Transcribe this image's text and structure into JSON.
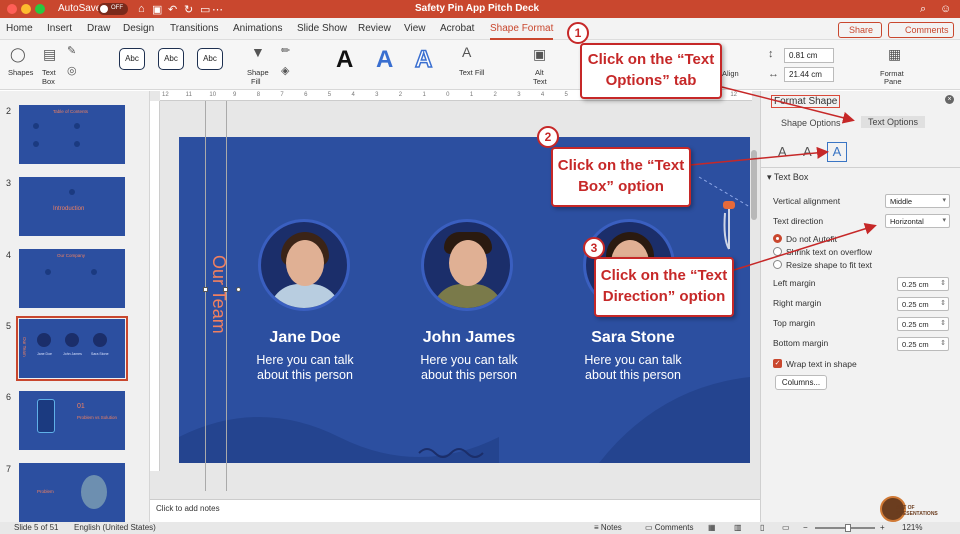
{
  "window": {
    "autosave_label": "AutoSave",
    "autosave_state": "OFF",
    "title": "Safety Pin App Pitch Deck"
  },
  "ribbon_tabs": [
    "Home",
    "Insert",
    "Draw",
    "Design",
    "Transitions",
    "Animations",
    "Slide Show",
    "Review",
    "View",
    "Acrobat",
    "Shape Format"
  ],
  "active_tab": "Shape Format",
  "header_buttons": {
    "share": "Share",
    "comments": "Comments"
  },
  "toolbar": {
    "shapes": "Shapes",
    "text_box_1": "Text",
    "text_box_2": "Box",
    "style_sample": "Abc",
    "shape_fill_1": "Shape",
    "shape_fill_2": "Fill",
    "wordart_letter": "A",
    "text_fill": "Text Fill",
    "alt_text_1": "Alt",
    "alt_text_2": "Text",
    "align": "Align",
    "height": "0.81 cm",
    "width": "21.44 cm",
    "format_pane_1": "Format",
    "format_pane_2": "Pane"
  },
  "slides": [
    {
      "num": "2",
      "title": "Table of Contents"
    },
    {
      "num": "3",
      "title": "Introduction"
    },
    {
      "num": "4",
      "title": "Our Company"
    },
    {
      "num": "5",
      "title": "Our Team"
    },
    {
      "num": "6",
      "title": "01",
      "subtitle": "Problem vs Solution"
    },
    {
      "num": "7",
      "title": "Problem"
    }
  ],
  "ruler_labels": [
    "12",
    "11",
    "10",
    "9",
    "8",
    "7",
    "6",
    "5",
    "4",
    "3",
    "2",
    "1",
    "0",
    "1",
    "2",
    "3",
    "4",
    "5",
    "6",
    "7",
    "8",
    "9",
    "10",
    "11",
    "12"
  ],
  "slide": {
    "title": "Our Team",
    "people": [
      {
        "name": "Jane Doe",
        "desc1": "Here you can talk",
        "desc2": "about this person"
      },
      {
        "name": "John James",
        "desc1": "Here you can talk",
        "desc2": "about this person"
      },
      {
        "name": "Sara Stone",
        "desc1": "Here you can talk",
        "desc2": "about this person"
      }
    ]
  },
  "notes_placeholder": "Click to add notes",
  "status": {
    "slide_of": "Slide 5 of 51",
    "language": "English (United States)",
    "notes": "Notes",
    "comments": "Comments",
    "zoom": "121%"
  },
  "format_pane": {
    "title": "Format Shape",
    "tab_shape": "Shape Options",
    "tab_text": "Text Options",
    "section": "Text Box",
    "vertical_alignment_label": "Vertical alignment",
    "vertical_alignment_value": "Middle",
    "text_direction_label": "Text direction",
    "text_direction_value": "Horizontal",
    "do_not_autofit": "Do not Autofit",
    "shrink_text": "Shrink text on overflow",
    "resize_shape": "Resize shape to fit text",
    "left_margin_label": "Left margin",
    "left_margin": "0.25 cm",
    "right_margin_label": "Right margin",
    "right_margin": "0.25 cm",
    "top_margin_label": "Top margin",
    "top_margin": "0.25 cm",
    "bottom_margin_label": "Bottom margin",
    "bottom_margin": "0.25 cm",
    "wrap_text": "Wrap text in shape",
    "columns_button": "Columns..."
  },
  "callouts": [
    {
      "num": "1",
      "line1": "Click on the “Text",
      "line2": "Options” tab"
    },
    {
      "num": "2",
      "line1": "Click on the “Text",
      "line2": "Box” option"
    },
    {
      "num": "3",
      "line1": "Click on the “Text",
      "line2": "Direction” option"
    }
  ],
  "logo_text": [
    "ART OF",
    "PRESENTATIONS"
  ],
  "colors": {
    "accent": "#c9472e",
    "slide_bg": "#2c4fa0",
    "callout_red": "#c62828",
    "slide_title": "#f08060"
  }
}
